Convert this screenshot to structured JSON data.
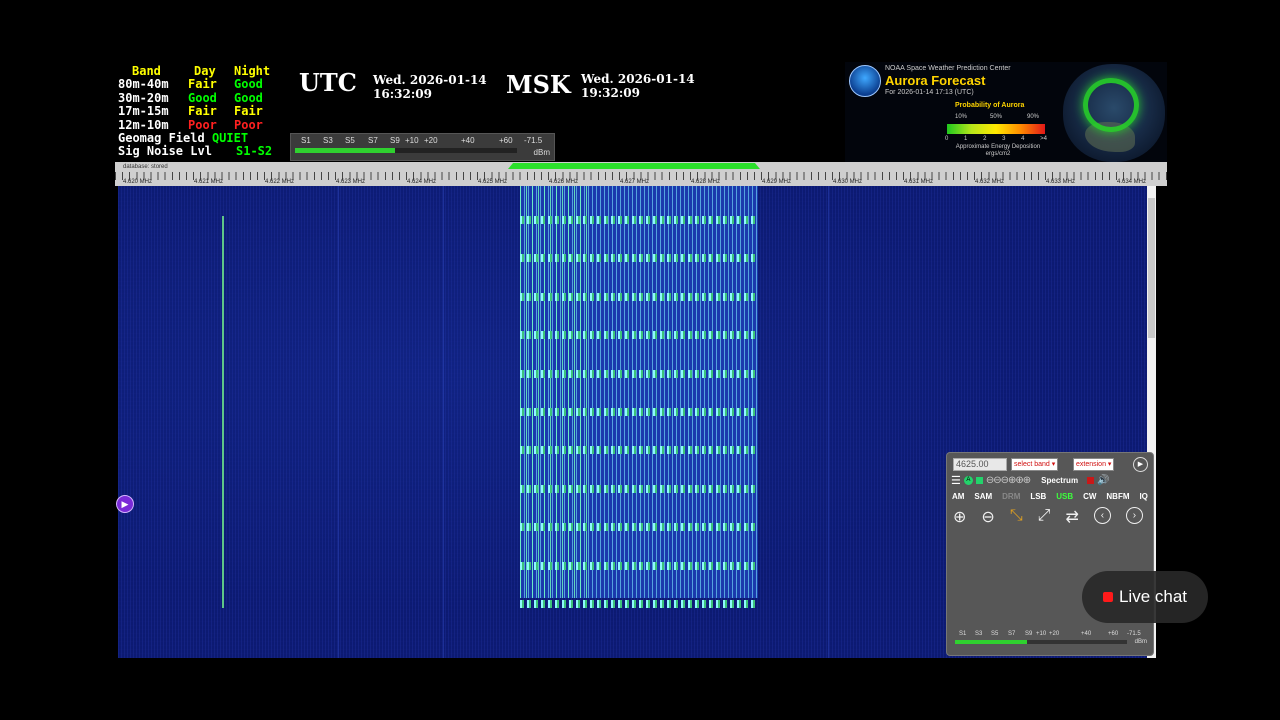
{
  "band_conditions": {
    "headers": [
      "Band",
      "Day",
      "Night"
    ],
    "rows": [
      {
        "band": "80m-40m",
        "day": "Fair",
        "night": "Good"
      },
      {
        "band": "30m-20m",
        "day": "Good",
        "night": "Good"
      },
      {
        "band": "17m-15m",
        "day": "Fair",
        "night": "Fair"
      },
      {
        "band": "12m-10m",
        "day": "Poor",
        "night": "Poor"
      }
    ],
    "geomag_label": "Geomag Field",
    "geomag_value": "QUIET",
    "noise_label": "Sig Noise Lvl",
    "noise_value": "S1-S2"
  },
  "clocks": {
    "utc_label": "UTC",
    "utc_date": "Wed. 2026-01-14",
    "utc_time": "16:32:09",
    "msk_label": "MSK",
    "msk_date": "Wed. 2026-01-14",
    "msk_time": "19:32:09"
  },
  "smeter": {
    "labels": [
      "S1",
      "S3",
      "S5",
      "S7",
      "S9",
      "+10",
      "+20",
      "+40",
      "+60",
      "-71.5"
    ],
    "unit": "dBm",
    "level_fraction": 0.45
  },
  "aurora": {
    "agency": "NOAA Space Weather Prediction Center",
    "title": "Aurora Forecast",
    "subtitle": "For 2026-01-14 17:13 (UTC)",
    "prob_label": "Probability of Aurora",
    "pcts": [
      "10%",
      "50%",
      "90%"
    ],
    "scale_nums": [
      "0",
      "1",
      "2",
      "3",
      "4",
      ">4"
    ],
    "note_line1": "Approximate Energy Deposition",
    "note_line2": "ergs/cm2"
  },
  "scale": {
    "db_label": "database: stored",
    "freqs": [
      "4.620 MHz",
      "4.621 MHz",
      "4.622 MHz",
      "4.623 MHz",
      "4.624 MHz",
      "4.625 MHz",
      "4.626 MHz",
      "4.627 MHz",
      "4.628 MHz",
      "4.629 MHz",
      "4.630 MHz",
      "4.631 MHz",
      "4.632 MHz",
      "4.633 MHz",
      "4.634 MHz"
    ]
  },
  "panel": {
    "freq_value": "4625.00",
    "band_select": "select band",
    "ext_select": "extension",
    "spectrum_label": "Spectrum",
    "modes": [
      "AM",
      "SAM",
      "DRM",
      "LSB",
      "USB",
      "CW",
      "NBFM",
      "IQ"
    ],
    "active_mode": "USB",
    "meter_labels": [
      "S1",
      "S3",
      "S5",
      "S7",
      "S9",
      "+10",
      "+20",
      "+40",
      "+60",
      "-71.5"
    ],
    "meter_unit": "dBm",
    "meter_level_fraction": 0.42
  },
  "live_chat_label": "Live chat",
  "colors": {
    "good": "#00ff00",
    "fair": "#ffff00",
    "poor": "#ff2020",
    "accent": "#2be02b"
  }
}
